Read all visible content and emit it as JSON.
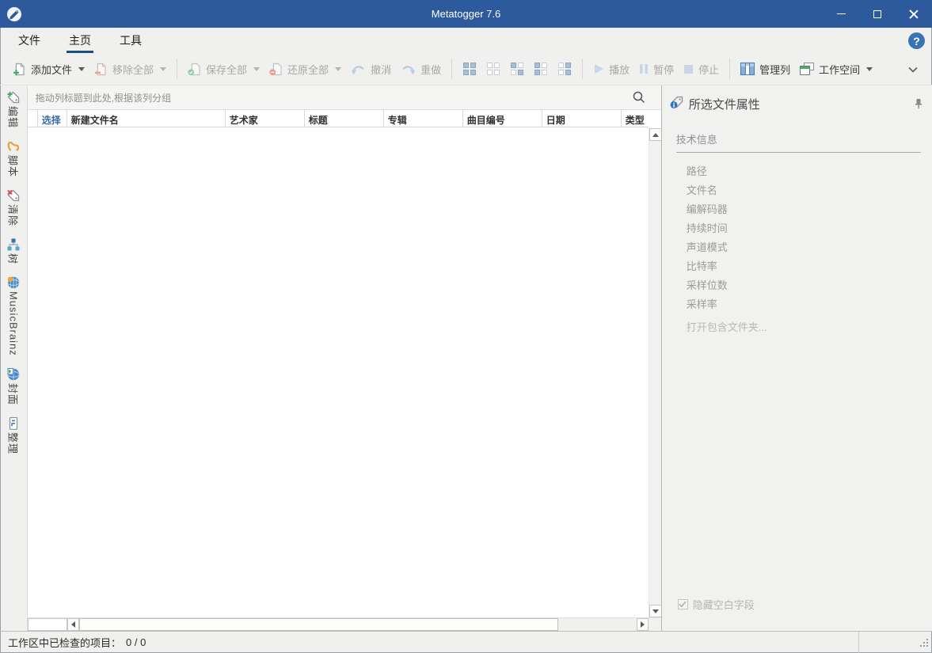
{
  "window": {
    "title": "Metatogger 7.6"
  },
  "colors": {
    "titlebar_blue": "#2d5a9c",
    "tab_underline_blue": "#1d4e7e",
    "help_blue": "#3a72b4",
    "select_link_blue": "#3c6ca8",
    "icon_green": "#3fae5c",
    "icon_red": "#e05d48",
    "disabled_icon_blue": "#a9c2de"
  },
  "menu": {
    "tabs": [
      {
        "label": "文件"
      },
      {
        "label": "主页"
      },
      {
        "label": "工具"
      }
    ],
    "help_glyph": "?"
  },
  "toolbar": {
    "add_files": "添加文件",
    "remove_all": "移除全部",
    "save_all": "保存全部",
    "restore_all": "还原全部",
    "undo": "撤消",
    "redo": "重做",
    "play": "播放",
    "pause": "暂停",
    "stop": "停止",
    "manage_columns": "管理列",
    "workspace": "工作空间"
  },
  "sidebar": {
    "items": [
      {
        "label": "编辑"
      },
      {
        "label": "脚本"
      },
      {
        "label": "清除"
      },
      {
        "label": "树"
      },
      {
        "label": "MusicBrainz"
      },
      {
        "label": "封面"
      },
      {
        "label": "整理"
      }
    ]
  },
  "main": {
    "group_hint": "拖动列标题到此处,根据该列分组",
    "columns": {
      "select": "选择",
      "new_filename": "新建文件名",
      "artist": "艺术家",
      "title": "标题",
      "album": "专辑",
      "track_number": "曲目编号",
      "date": "日期",
      "type": "类型"
    }
  },
  "properties": {
    "title": "所选文件属性",
    "section_technical": "技术信息",
    "fields": [
      {
        "label": "路径"
      },
      {
        "label": "文件名"
      },
      {
        "label": "编解码器"
      },
      {
        "label": "持续时间"
      },
      {
        "label": "声道模式"
      },
      {
        "label": "比特率"
      },
      {
        "label": "采样位数"
      },
      {
        "label": "采样率"
      }
    ],
    "open_folder": "打开包含文件夹...",
    "hide_empty": "隐藏空白字段"
  },
  "status": {
    "label": "工作区中已检查的项目：",
    "value": "0 / 0"
  }
}
